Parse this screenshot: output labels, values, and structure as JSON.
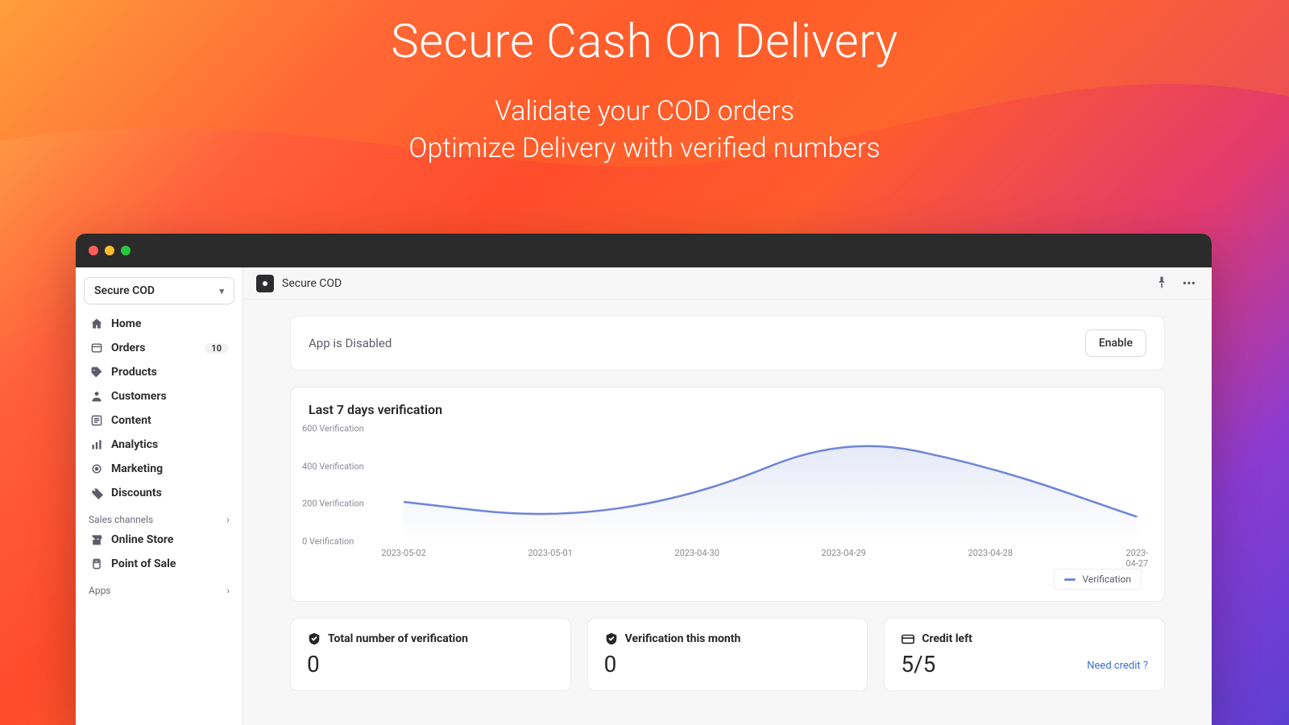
{
  "hero": {
    "title": "Secure Cash On Delivery",
    "subtitle_line1": "Validate your COD orders",
    "subtitle_line2": "Optimize Delivery with verified numbers"
  },
  "sidebar": {
    "store_name": "Secure COD",
    "items": [
      {
        "icon": "home",
        "label": "Home"
      },
      {
        "icon": "orders",
        "label": "Orders",
        "badge": "10"
      },
      {
        "icon": "tag",
        "label": "Products"
      },
      {
        "icon": "user",
        "label": "Customers"
      },
      {
        "icon": "content",
        "label": "Content"
      },
      {
        "icon": "analytics",
        "label": "Analytics"
      },
      {
        "icon": "marketing",
        "label": "Marketing"
      },
      {
        "icon": "discount",
        "label": "Discounts"
      }
    ],
    "sales_channels_label": "Sales channels",
    "channel_items": [
      {
        "icon": "store",
        "label": "Online Store"
      },
      {
        "icon": "pos",
        "label": "Point of Sale"
      }
    ],
    "apps_label": "Apps"
  },
  "appbar": {
    "title": "Secure COD"
  },
  "status": {
    "text": "App is Disabled",
    "button": "Enable"
  },
  "chart_data": {
    "type": "area",
    "title": "Last 7 days verification",
    "ylabel_suffix": "Verification",
    "ylim": [
      0,
      600
    ],
    "y_ticks": [
      0,
      200,
      400,
      600
    ],
    "categories": [
      "2023-05-02",
      "2023-05-01",
      "2023-04-30",
      "2023-04-29",
      "2023-04-28",
      "2023-04-27"
    ],
    "series": [
      {
        "name": "Verification",
        "color": "#6f86d6",
        "values": [
          210,
          120,
          240,
          560,
          400,
          130
        ]
      }
    ]
  },
  "stats": {
    "total": {
      "label": "Total number of verification",
      "value": "0"
    },
    "month": {
      "label": "Verification this month",
      "value": "0"
    },
    "credit": {
      "label": "Credit left",
      "value": "5/5",
      "link": "Need credit ?"
    }
  }
}
